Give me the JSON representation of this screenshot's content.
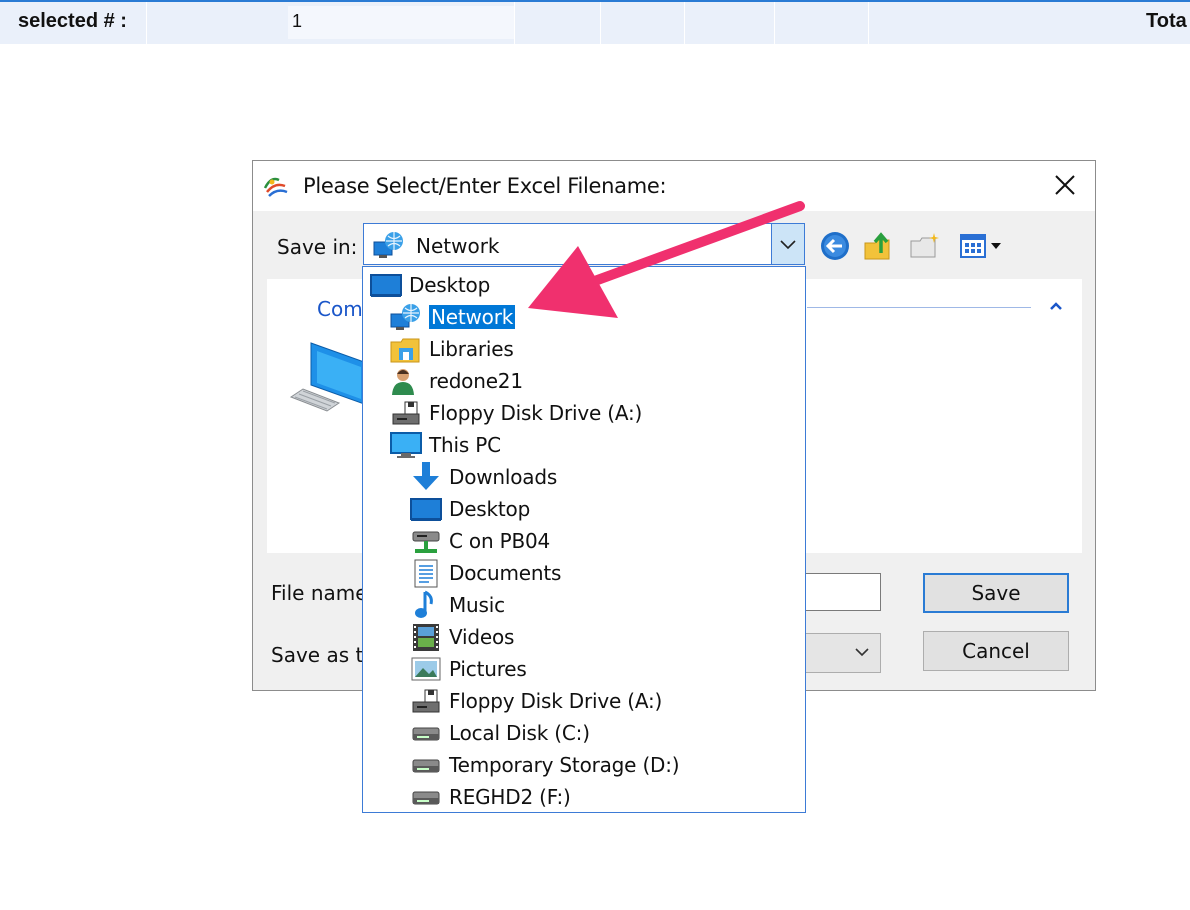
{
  "top_bar": {
    "label": "selected # :",
    "value": "1",
    "right_label": "Tota"
  },
  "dialog": {
    "title": "Please Select/Enter Excel Filename:",
    "save_in_label": "Save in:",
    "save_in_value": "Network",
    "file_pane_partial": "Com",
    "file_name_label": "File name",
    "save_as_type_label": "Save as ty",
    "save_button": "Save",
    "cancel_button": "Cancel"
  },
  "dropdown_items": [
    {
      "label": "Desktop",
      "icon": "desktop-icon",
      "level": 0
    },
    {
      "label": "Network",
      "icon": "network-icon",
      "level": 1,
      "selected": true
    },
    {
      "label": "Libraries",
      "icon": "libraries-icon",
      "level": 1
    },
    {
      "label": "redone21",
      "icon": "user-icon",
      "level": 1
    },
    {
      "label": "Floppy Disk Drive (A:)",
      "icon": "floppy-drive-icon",
      "level": 1
    },
    {
      "label": "This PC",
      "icon": "this-pc-icon",
      "level": 1
    },
    {
      "label": "Downloads",
      "icon": "downloads-icon",
      "level": 2
    },
    {
      "label": "Desktop",
      "icon": "desktop-icon",
      "level": 2
    },
    {
      "label": "C on PB04",
      "icon": "network-drive-icon",
      "level": 2
    },
    {
      "label": "Documents",
      "icon": "documents-icon",
      "level": 2
    },
    {
      "label": "Music",
      "icon": "music-icon",
      "level": 2
    },
    {
      "label": "Videos",
      "icon": "videos-icon",
      "level": 2
    },
    {
      "label": "Pictures",
      "icon": "pictures-icon",
      "level": 2
    },
    {
      "label": "Floppy Disk Drive (A:)",
      "icon": "floppy-drive-icon",
      "level": 2
    },
    {
      "label": "Local Disk (C:)",
      "icon": "disk-drive-icon",
      "level": 2
    },
    {
      "label": "Temporary Storage (D:)",
      "icon": "disk-drive-icon",
      "level": 2
    },
    {
      "label": "REGHD2 (F:)",
      "icon": "disk-drive-icon",
      "level": 2
    }
  ],
  "colors": {
    "accent": "#0078d7",
    "annotation_arrow": "#f0306e",
    "link": "#1a56c9"
  }
}
